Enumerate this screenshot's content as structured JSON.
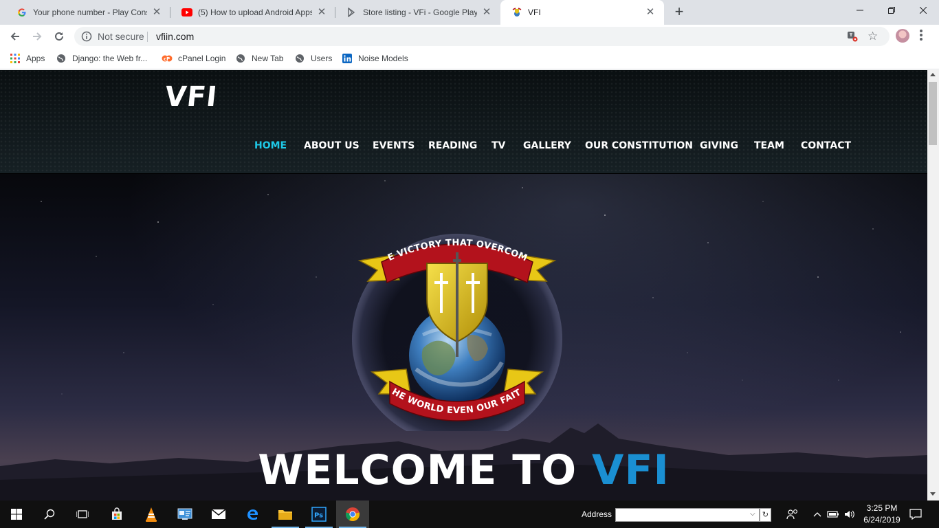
{
  "browser": {
    "tabs": [
      {
        "title": "Your phone number - Play Conso",
        "favicon": "google-g-icon"
      },
      {
        "title": "(5) How to upload Android Apps",
        "favicon": "youtube-icon"
      },
      {
        "title": "Store listing - VFi - Google Play C",
        "favicon": "google-play-icon"
      },
      {
        "title": "VFI",
        "favicon": "vfi-emblem-icon",
        "active": true
      }
    ],
    "omnibox": {
      "security_text": "Not secure",
      "url": "vfiin.com"
    },
    "bookmarks": [
      {
        "label": "Apps",
        "icon": "apps-grid-icon"
      },
      {
        "label": "Django: the Web fr...",
        "icon": "globe-icon"
      },
      {
        "label": "cPanel Login",
        "icon": "cpanel-icon"
      },
      {
        "label": "New Tab",
        "icon": "globe-icon"
      },
      {
        "label": "Users",
        "icon": "globe-icon"
      },
      {
        "label": "Noise Models",
        "icon": "linkedin-icon"
      }
    ]
  },
  "site": {
    "logo": "VFI",
    "nav": [
      {
        "label": "HOME",
        "active": true
      },
      {
        "label": "ABOUT US"
      },
      {
        "label": "EVENTS"
      },
      {
        "label": "READING"
      },
      {
        "label": "TV"
      },
      {
        "label": "GALLERY"
      },
      {
        "label": "OUR CONSTITUTION"
      },
      {
        "label": "GIVING"
      },
      {
        "label": "TEAM"
      },
      {
        "label": "CONTACT"
      }
    ],
    "emblem": {
      "top_banner": "THE VICTORY THAT OVERCOMES",
      "bottom_banner": "THE WORLD EVEN OUR FAITH"
    },
    "hero": {
      "welcome_prefix": "WELCOME TO ",
      "welcome_accent": "VFI"
    }
  },
  "taskbar": {
    "address_label": "Address",
    "time": "3:25 PM",
    "date": "6/24/2019"
  },
  "colors": {
    "nav_active": "#1ec8e6",
    "welcome_accent": "#1a8fd2",
    "banner_red": "#b3121c",
    "banner_gold": "#f2d611"
  }
}
